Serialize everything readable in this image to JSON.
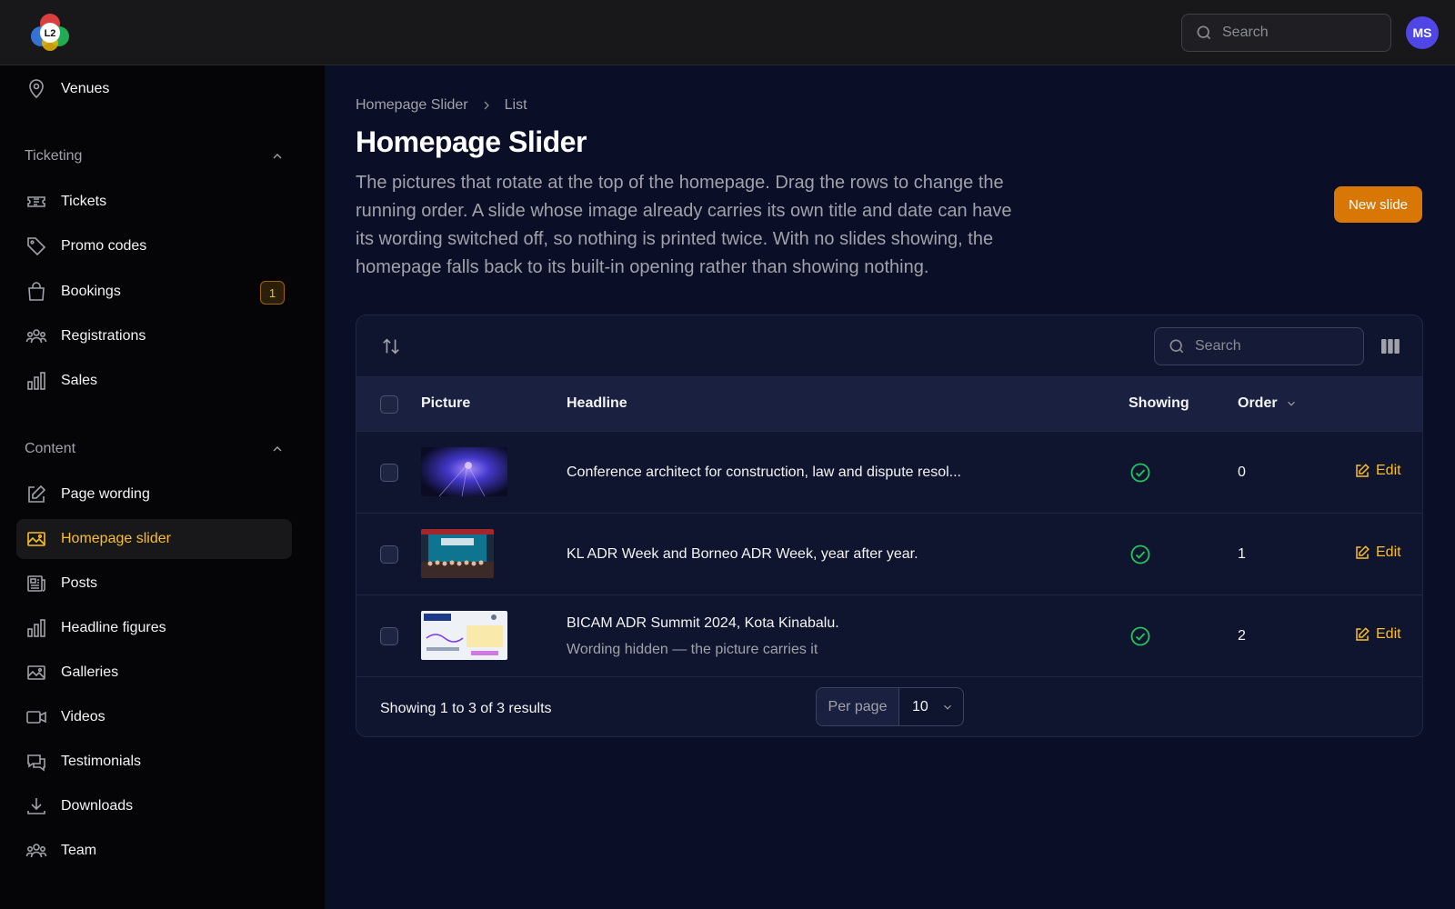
{
  "app": {
    "logo_text": "L2"
  },
  "topbar": {
    "search_placeholder": "Search",
    "avatar_initials": "MS"
  },
  "sidebar": {
    "venues": {
      "label": "Venues",
      "icon": "map-pin-icon"
    },
    "ticketing": {
      "heading": "Ticketing",
      "items": [
        {
          "label": "Tickets",
          "icon": "ticket-icon"
        },
        {
          "label": "Promo codes",
          "icon": "tag-icon"
        },
        {
          "label": "Bookings",
          "icon": "shopping-bag-icon",
          "badge": "1"
        },
        {
          "label": "Registrations",
          "icon": "users-icon"
        },
        {
          "label": "Sales",
          "icon": "bar-chart-icon"
        }
      ]
    },
    "content": {
      "heading": "Content",
      "items": [
        {
          "label": "Page wording",
          "icon": "pencil-square-icon"
        },
        {
          "label": "Homepage slider",
          "icon": "photo-icon",
          "active": true
        },
        {
          "label": "Posts",
          "icon": "newspaper-icon"
        },
        {
          "label": "Headline figures",
          "icon": "bar-chart-icon"
        },
        {
          "label": "Galleries",
          "icon": "photo-icon"
        },
        {
          "label": "Videos",
          "icon": "video-camera-icon"
        },
        {
          "label": "Testimonials",
          "icon": "chat-bubbles-icon"
        },
        {
          "label": "Downloads",
          "icon": "download-icon"
        },
        {
          "label": "Team",
          "icon": "users-icon"
        }
      ]
    }
  },
  "breadcrumb": [
    "Homepage Slider",
    "List"
  ],
  "page": {
    "title": "Homepage Slider",
    "description": "The pictures that rotate at the top of the homepage. Drag the rows to change the running order. A slide whose image already carries its own title and date can have its wording switched off, so nothing is printed twice. With no slides showing, the homepage falls back to its built-in opening rather than showing nothing.",
    "new_button": "New slide"
  },
  "table": {
    "search_placeholder": "Search",
    "columns": {
      "picture": "Picture",
      "headline": "Headline",
      "showing": "Showing",
      "order": "Order"
    },
    "rows": [
      {
        "headline": "Conference architect for construction, law and dispute resol...",
        "sub": "",
        "showing": true,
        "order": "0",
        "edit": "Edit"
      },
      {
        "headline": "KL ADR Week and Borneo ADR Week, year after year.",
        "sub": "",
        "showing": true,
        "order": "1",
        "edit": "Edit"
      },
      {
        "headline": "BICAM ADR Summit 2024, Kota Kinabalu.",
        "sub": "Wording hidden — the picture carries it",
        "showing": true,
        "order": "2",
        "edit": "Edit"
      }
    ],
    "footer": {
      "results": "Showing 1 to 3 of 3 results",
      "per_page_label": "Per page",
      "per_page_value": "10"
    }
  },
  "colors": {
    "accent": "#fbbf24",
    "primary_button": "#d97706",
    "success": "#22c55e",
    "avatar": "#4f46e5"
  }
}
